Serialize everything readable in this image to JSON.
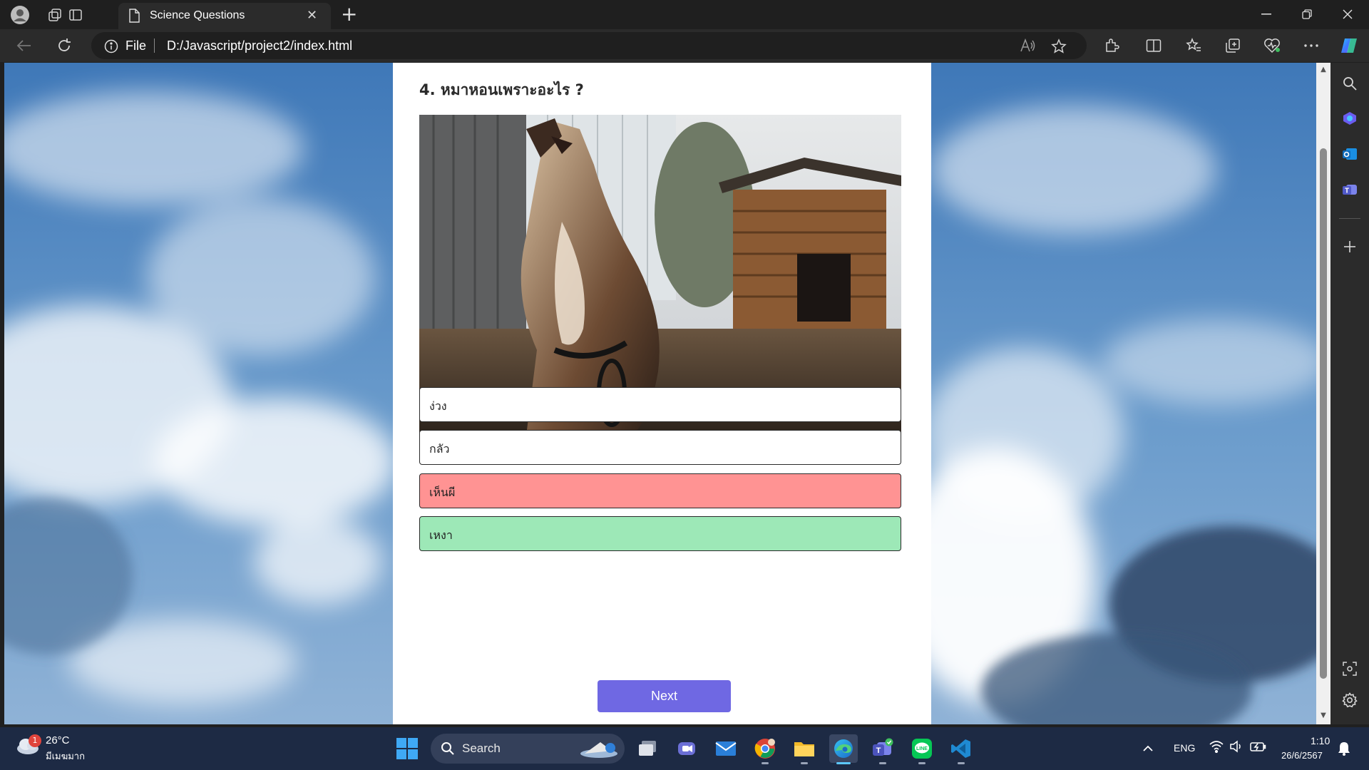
{
  "browser": {
    "tab_title": "Science Questions",
    "address_scheme": "File",
    "address_url": "D:/Javascript/project2/index.html"
  },
  "quiz": {
    "question": "4. หมาหอนเพราะอะไร ?",
    "image_subject": "howling dog in front of wooden dog house",
    "answers": [
      {
        "text": "ง่วง",
        "state": "default"
      },
      {
        "text": "กลัว",
        "state": "default"
      },
      {
        "text": "เห็นผี",
        "state": "wrong"
      },
      {
        "text": "เหงา",
        "state": "correct"
      }
    ],
    "next_label": "Next",
    "colors": {
      "wrong": "#ff9393",
      "correct": "#9de8b7",
      "next_button": "#6f68e3"
    }
  },
  "taskbar": {
    "weather_temp": "26°C",
    "weather_desc": "มีเมฆมาก",
    "weather_badge": "1",
    "search_label": "Search",
    "language": "ENG",
    "time": "1:10",
    "date": "26/6/2567"
  }
}
